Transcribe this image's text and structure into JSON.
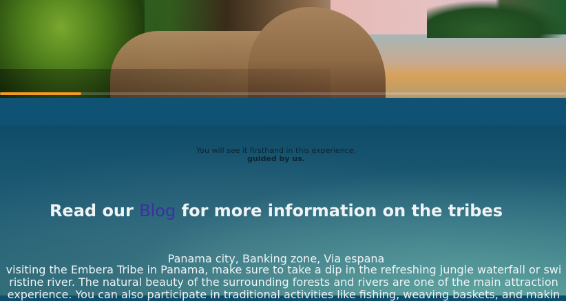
{
  "hero": {
    "image": "tropical-beach-huts-image",
    "slider_progress": 0.143,
    "accent_color": "#f39a21"
  },
  "quote": {
    "line1": "You will see it firsthand in this experience,",
    "line2": "guided by us."
  },
  "blog": {
    "prefix": "Read our ",
    "link": "Blog",
    "suffix": " for more information on the tribes"
  },
  "location": {
    "address": "Panama city, Banking zone, Via espana"
  },
  "description": {
    "line1": "visiting the Embera Tribe in Panama, make sure to take a dip in the refreshing jungle waterfall or swi",
    "line2": "ristine river. The natural beauty of the surrounding forests and rivers are one of the main attraction",
    "line3": "experience. You can also participate in traditional activities like fishing, weaving baskets, and makin"
  },
  "colors": {
    "band": "#0f5273",
    "link": "#3b2fa3",
    "text": "#eef3f6"
  }
}
